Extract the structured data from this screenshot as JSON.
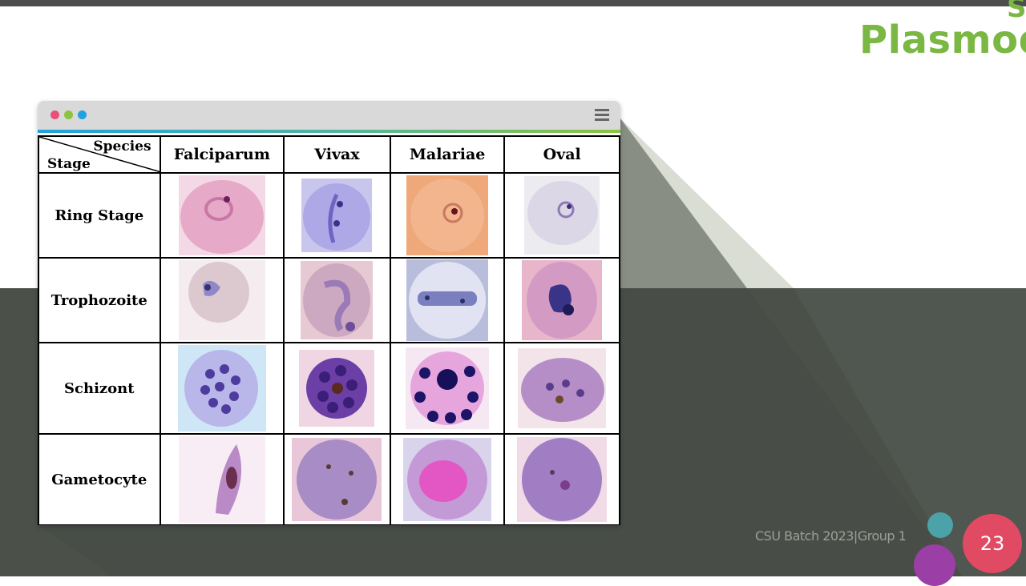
{
  "slide": {
    "title": "Plasmod",
    "title_fragment": "S",
    "footer": "CSU Batch 2023|Group 1",
    "page_number": "23"
  },
  "table": {
    "corner_species": "Species",
    "corner_stage": "Stage",
    "columns": [
      "Falciparum",
      "Vivax",
      "Malariae",
      "Oval"
    ],
    "rows": [
      {
        "stage": "Ring Stage"
      },
      {
        "stage": "Trophozoite"
      },
      {
        "stage": "Schizont"
      },
      {
        "stage": "Gametocyte"
      }
    ]
  },
  "colors": {
    "title": "#7ab743",
    "dark_band": "#4b5149",
    "accent_dot_red": "#e94f7a",
    "accent_dot_green": "#8cc43f",
    "accent_dot_blue": "#1ea2e0",
    "page_circle": "#e04a63",
    "teal_circle": "#4ba3a9",
    "purple_circle": "#9b3ea5"
  },
  "icons": {
    "window_menu": "hamburger-menu-icon"
  }
}
